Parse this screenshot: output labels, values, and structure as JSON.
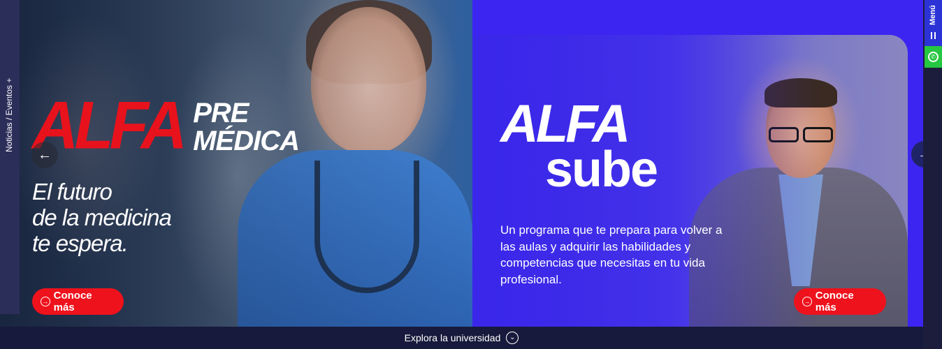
{
  "side_tab": {
    "label": "Noticias / Eventos +"
  },
  "slide_left": {
    "brand_main": "ALFA",
    "brand_line1": "PRE",
    "brand_line2": "MÉDICA",
    "tagline": "El futuro\nde la medicina\nte espera.",
    "cta_label": "Conoce más",
    "cta_icon": "arrow-circle-icon"
  },
  "slide_right": {
    "brand_main": "ALFA",
    "brand_sub": "sube",
    "description": "Un programa que te prepara para volver a las aulas y adquirir las habilidades y competencias que necesitas en tu vida profesional.",
    "cta_label": "Conoce más",
    "cta_icon": "arrow-circle-icon"
  },
  "carousel": {
    "prev_icon": "arrow-left-icon",
    "next_icon": "arrow-right-icon"
  },
  "right_menu": {
    "menu_label": "Menú",
    "menu_icon": "pause-bars-icon",
    "whatsapp_icon": "whatsapp-icon"
  },
  "bottom_bar": {
    "label": "Explora la universidad",
    "icon": "chevron-down-circle-icon"
  },
  "colors": {
    "accent_red": "#ee121c",
    "accent_blue": "#3c25f0",
    "nav_dark": "#171a3c",
    "whatsapp_green": "#25c641"
  }
}
